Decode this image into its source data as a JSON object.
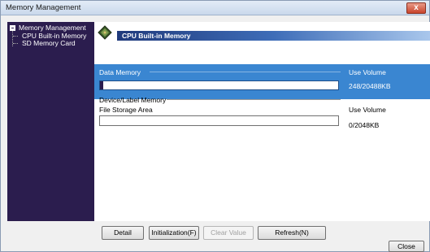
{
  "window": {
    "title": "Memory Management",
    "close_glyph": "x"
  },
  "sidebar": {
    "root": "Memory Management",
    "items": [
      {
        "label": "CPU Built-in Memory"
      },
      {
        "label": "SD Memory Card"
      }
    ]
  },
  "header": {
    "label": "CPU Built-in Memory",
    "icon": "cpu-chip-icon"
  },
  "data_memory": {
    "label": "Data Memory",
    "use_volume_label": "Use Volume",
    "value": "248/20488KB",
    "used_fraction": 0.0121
  },
  "device_label": {
    "title": "Device/Label Memory",
    "file_storage_label": "File Storage Area",
    "use_volume_label": "Use Volume",
    "value": "0/2048KB",
    "used_fraction": 0
  },
  "buttons": {
    "detail": "Detail",
    "initialization": "Initialization(F)",
    "clear_value": "Clear Value",
    "refresh": "Refresh(N)",
    "close": "Close"
  },
  "colors": {
    "sidebar_bg": "#2b1d4e",
    "band_bg": "#3a86d1",
    "header_gradient_start": "#203a7c",
    "header_gradient_end": "#a9c7ec"
  }
}
